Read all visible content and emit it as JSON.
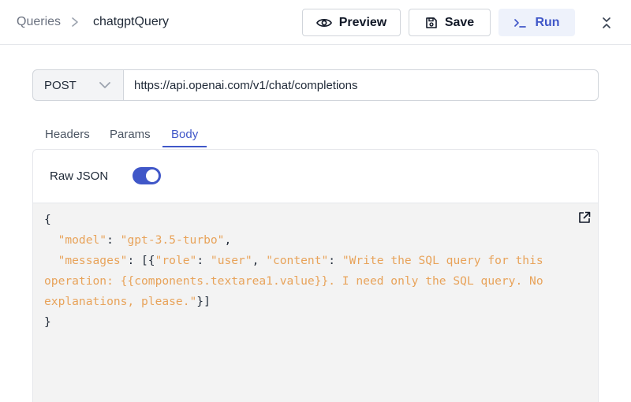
{
  "breadcrumb": {
    "root": "Queries",
    "current": "chatgptQuery"
  },
  "toolbar": {
    "preview_label": "Preview",
    "save_label": "Save",
    "run_label": "Run"
  },
  "request": {
    "method": "POST",
    "url": "https://api.openai.com/v1/chat/completions"
  },
  "tabs": [
    {
      "label": "Headers"
    },
    {
      "label": "Params"
    },
    {
      "label": "Body",
      "active": true
    }
  ],
  "body_panel": {
    "raw_json_label": "Raw JSON",
    "raw_json_enabled": true,
    "code": {
      "open_brace": "{",
      "model_key": "\"model\"",
      "model_value": "\"gpt-3.5-turbo\"",
      "messages_key": "\"messages\"",
      "role_key": "\"role\"",
      "role_value": "\"user\"",
      "content_key": "\"content\"",
      "content_value": "\"Write the SQL query for this operation: {{components.textarea1.value}}. I need only the SQL query. No explanations, please.\"",
      "close_brace": "}"
    }
  },
  "icons": [
    "chevron-right-icon",
    "eye-icon",
    "save-icon",
    "terminal-icon",
    "expand-collapse-icon",
    "chevron-down-icon",
    "external-link-icon"
  ],
  "colors": {
    "accent": "#4057c8",
    "string": "#e8a35a",
    "editor_bg": "#f3f3f3"
  }
}
